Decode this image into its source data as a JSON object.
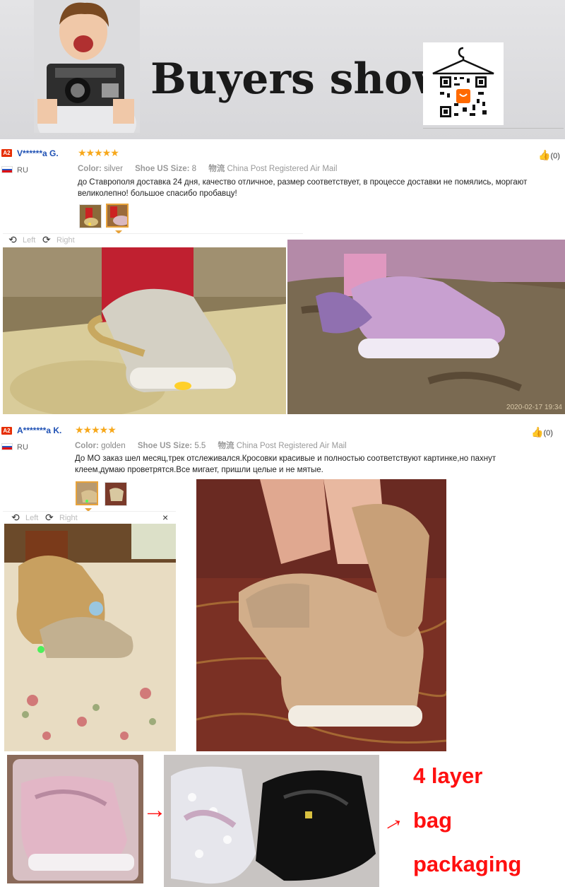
{
  "banner": {
    "title": "Buyers show",
    "icons": [
      "boy-with-camera-image",
      "hanger-icon",
      "qr-code-icon",
      "aliexpress-logo"
    ]
  },
  "reviews": [
    {
      "badge": "A2",
      "user": "V******a G.",
      "country": "RU",
      "stars": "★★★★★",
      "color_label": "Color:",
      "color_value": "silver",
      "size_label": "Shoe US Size:",
      "size_value": "8",
      "ship_label": "物流",
      "ship_value": "China Post Registered Air Mail",
      "text": "до Ставрополя доставка 24 дня, качество отличное, размер соответствует, в процессе доставки не помялись, моргают великолепно! большое спасибо пробавцу!",
      "likes": "(0)",
      "rotate_left": "Left",
      "rotate_right": "Right",
      "photo_timestamp": "2020-02-17 19:34"
    },
    {
      "badge": "A2",
      "user": "A*******a K.",
      "country": "RU",
      "stars": "★★★★★",
      "color_label": "Color:",
      "color_value": "golden",
      "size_label": "Shoe US Size:",
      "size_value": "5.5",
      "ship_label": "物流",
      "ship_value": "China Post Registered Air Mail",
      "text": "До МО заказ шел месяц,трек отслеживался.Кросовки красивые и полностью соответствуют картинке,но пахнут клеем,думаю проветрятся.Все мигает, пришли целые и не мятые.",
      "likes": "(0)",
      "rotate_left": "Left",
      "rotate_right": "Right",
      "close": "×"
    }
  ],
  "packaging": {
    "line1": "4 layer",
    "line2": "bag",
    "line3": "packaging",
    "arrow": "→"
  },
  "colors": {
    "accent_red": "#ff1010",
    "star": "#f7a81b",
    "user_link": "#1e50b4",
    "badge": "#e62e04"
  }
}
